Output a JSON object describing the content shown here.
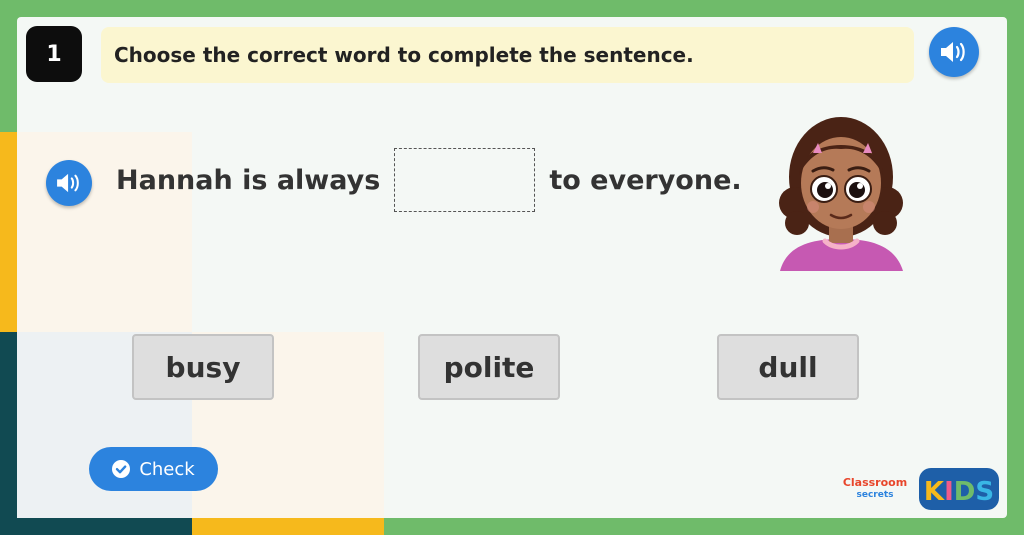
{
  "question": {
    "number": "1",
    "instruction": "Choose the correct word to complete the sentence.",
    "sentence_before": "Hannah is always",
    "sentence_after": "to everyone."
  },
  "options": [
    "busy",
    "polite",
    "dull"
  ],
  "check_button": {
    "label": "Check"
  },
  "brand": {
    "classroom": "Classroom",
    "secrets": "secrets",
    "kids": "KIDS"
  },
  "icons": {
    "instruction_audio": "speaker-icon",
    "sentence_audio": "speaker-icon",
    "check": "check-circle-icon",
    "character": "girl-avatar"
  },
  "colors": {
    "accent_blue": "#2c83de",
    "instruction_bg": "#fbf6d0",
    "page_green": "#6fbb6a"
  }
}
